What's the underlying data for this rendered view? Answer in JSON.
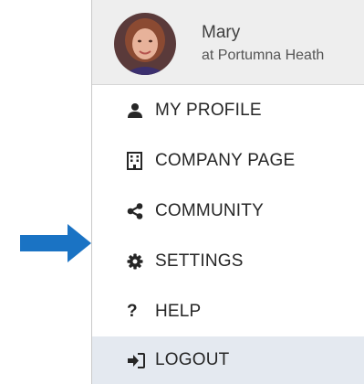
{
  "user": {
    "name": "Mary",
    "company": "at Portumna Heath"
  },
  "menu": {
    "items": [
      {
        "label": "MY PROFILE",
        "icon": "user-icon"
      },
      {
        "label": "COMPANY PAGE",
        "icon": "building-icon"
      },
      {
        "label": "COMMUNITY",
        "icon": "share-icon"
      },
      {
        "label": "SETTINGS",
        "icon": "gear-icon"
      },
      {
        "label": "HELP",
        "icon": "question-icon",
        "icon_text": "?"
      },
      {
        "label": "LOGOUT",
        "icon": "sign-out-icon"
      }
    ]
  },
  "colors": {
    "header_background": "#eeeeee",
    "hover_background": "#e4e9f0",
    "arrow": "#1a73c4",
    "text": "#262626"
  }
}
